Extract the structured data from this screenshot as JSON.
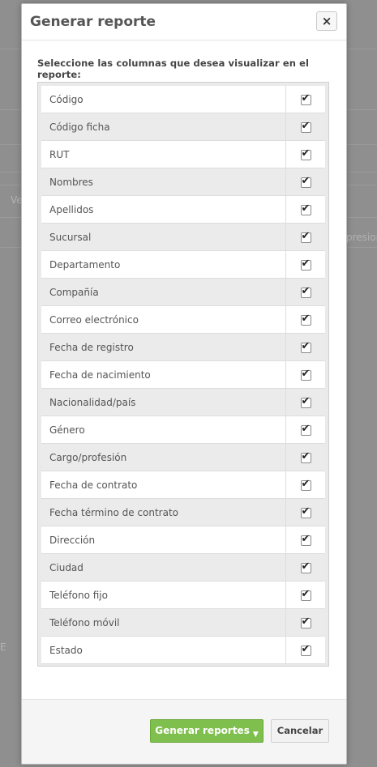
{
  "background": {
    "left_fragment": "Ve",
    "right_fragment": "presion",
    "edge_mark": "E"
  },
  "modal": {
    "title": "Generar reporte",
    "close_glyph": "×",
    "instruction": "Seleccione las columnas que desea visualizar en el reporte:",
    "columns": [
      {
        "label": "Código",
        "checked": true
      },
      {
        "label": "Código ficha",
        "checked": true
      },
      {
        "label": "RUT",
        "checked": true
      },
      {
        "label": "Nombres",
        "checked": true
      },
      {
        "label": "Apellidos",
        "checked": true
      },
      {
        "label": "Sucursal",
        "checked": true
      },
      {
        "label": "Departamento",
        "checked": true
      },
      {
        "label": "Compañía",
        "checked": true
      },
      {
        "label": "Correo electrónico",
        "checked": true
      },
      {
        "label": "Fecha de registro",
        "checked": true
      },
      {
        "label": "Fecha de nacimiento",
        "checked": true
      },
      {
        "label": "Nacionalidad/país",
        "checked": true
      },
      {
        "label": "Género",
        "checked": true
      },
      {
        "label": "Cargo/profesión",
        "checked": true
      },
      {
        "label": "Fecha de contrato",
        "checked": true
      },
      {
        "label": "Fecha término de contrato",
        "checked": true
      },
      {
        "label": "Dirección",
        "checked": true
      },
      {
        "label": "Ciudad",
        "checked": true
      },
      {
        "label": "Teléfono fijo",
        "checked": true
      },
      {
        "label": "Teléfono móvil",
        "checked": true
      },
      {
        "label": "Estado",
        "checked": true
      }
    ],
    "footer": {
      "primary_label": "Generar reportes",
      "cancel_label": "Cancelar"
    }
  },
  "colors": {
    "overlay": "#8f8f8f",
    "primary_button": "#7fbf4d",
    "row_alt": "#ebebeb"
  }
}
